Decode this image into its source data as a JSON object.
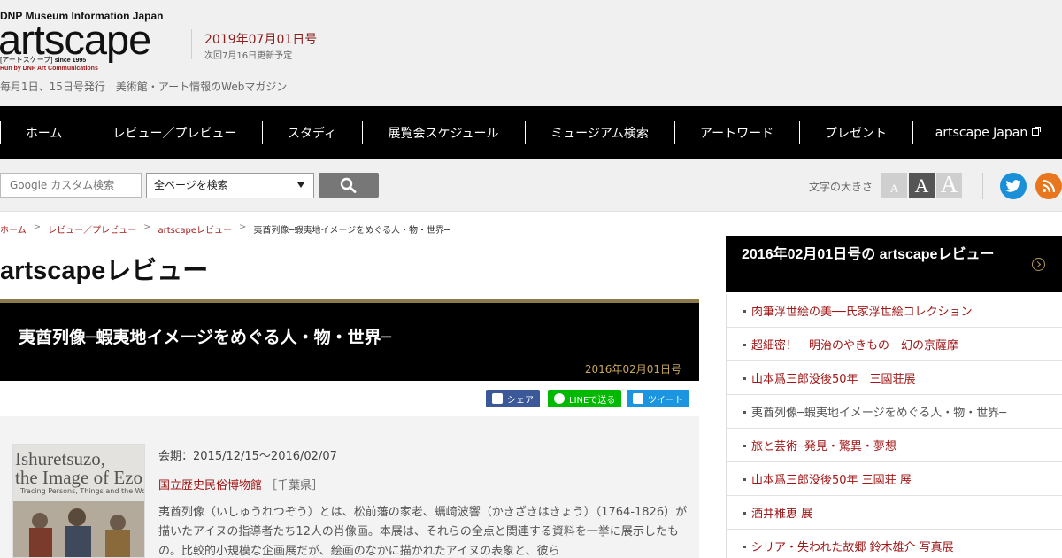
{
  "header": {
    "brand_top": "DNP Museum Information Japan",
    "logo": "artscape",
    "logo_sub": "[アートスケープ]",
    "logo_since": "since 1995",
    "logo_run": "Run by DNP Art Communications",
    "issue_date": "2019年07月01日号",
    "next_update": "次回7月16日更新予定",
    "tagline": "毎月1日、15日号発行　美術館・アート情報のWebマガジン"
  },
  "nav": {
    "items": [
      "ホーム",
      "レビュー／プレビュー",
      "スタディ",
      "展覧会スケジュール",
      "ミュージアム検索",
      "アートワード",
      "プレゼント",
      "artscape Japan"
    ]
  },
  "search": {
    "placeholder": "Google カスタム検索",
    "scope": "全ページを検索",
    "font_size_label": "文字の大きさ",
    "font_sizes": [
      "A",
      "A",
      "A"
    ]
  },
  "breadcrumb": [
    "ホーム",
    "レビュー／プレビュー",
    "artscapeレビュー",
    "夷酋列像─蝦夷地イメージをめぐる人・物・世界─"
  ],
  "page_title": "artscapeレビュー",
  "article": {
    "title": "夷酋列像─蝦夷地イメージをめぐる人・物・世界─",
    "date": "2016年02月01日号",
    "share": {
      "facebook": "シェア",
      "line": "LINEで送る",
      "twitter": "ツイート"
    },
    "image": {
      "title_line1": "Ishuretsuzo,",
      "title_line2": "the Image of Ezo",
      "subtitle": "Tracing Persons, Things and the World"
    },
    "period": "会期：2015/12/15～2016/02/07",
    "venue": "国立歴史民俗博物館",
    "venue_pref": "［千葉県］",
    "text": "夷酋列像（いしゅうれつぞう）とは、松前藩の家老、蠣崎波響（かきざきはきょう）（1764-1826）が描いたアイヌの指導者たち12人の肖像画。本展は、それらの全点と関連する資料を一挙に展示したもの。比較的小規模な企画展だが、絵画のなかに描かれたアイヌの表象と、彼ら"
  },
  "sidebar": {
    "title": "2016年02月01日号の artscapeレビュー",
    "items": [
      "肉筆浮世絵の美──氏家浮世絵コレクション",
      "超細密！　明治のやきもの　幻の京薩摩",
      "山本爲三郎没後50年　三國荘展",
      "夷酋列像─蝦夷地イメージをめぐる人・物・世界─",
      "旅と芸術─発見・驚異・夢想",
      "山本爲三郎没後50年 三國荘 展",
      "酒井稚恵 展",
      "シリア・失われた故郷 鈴木雄介 写真展"
    ]
  },
  "colors": {
    "accent_red": "#a01818",
    "gold": "#c8a85a",
    "nav_bg": "#000000"
  }
}
